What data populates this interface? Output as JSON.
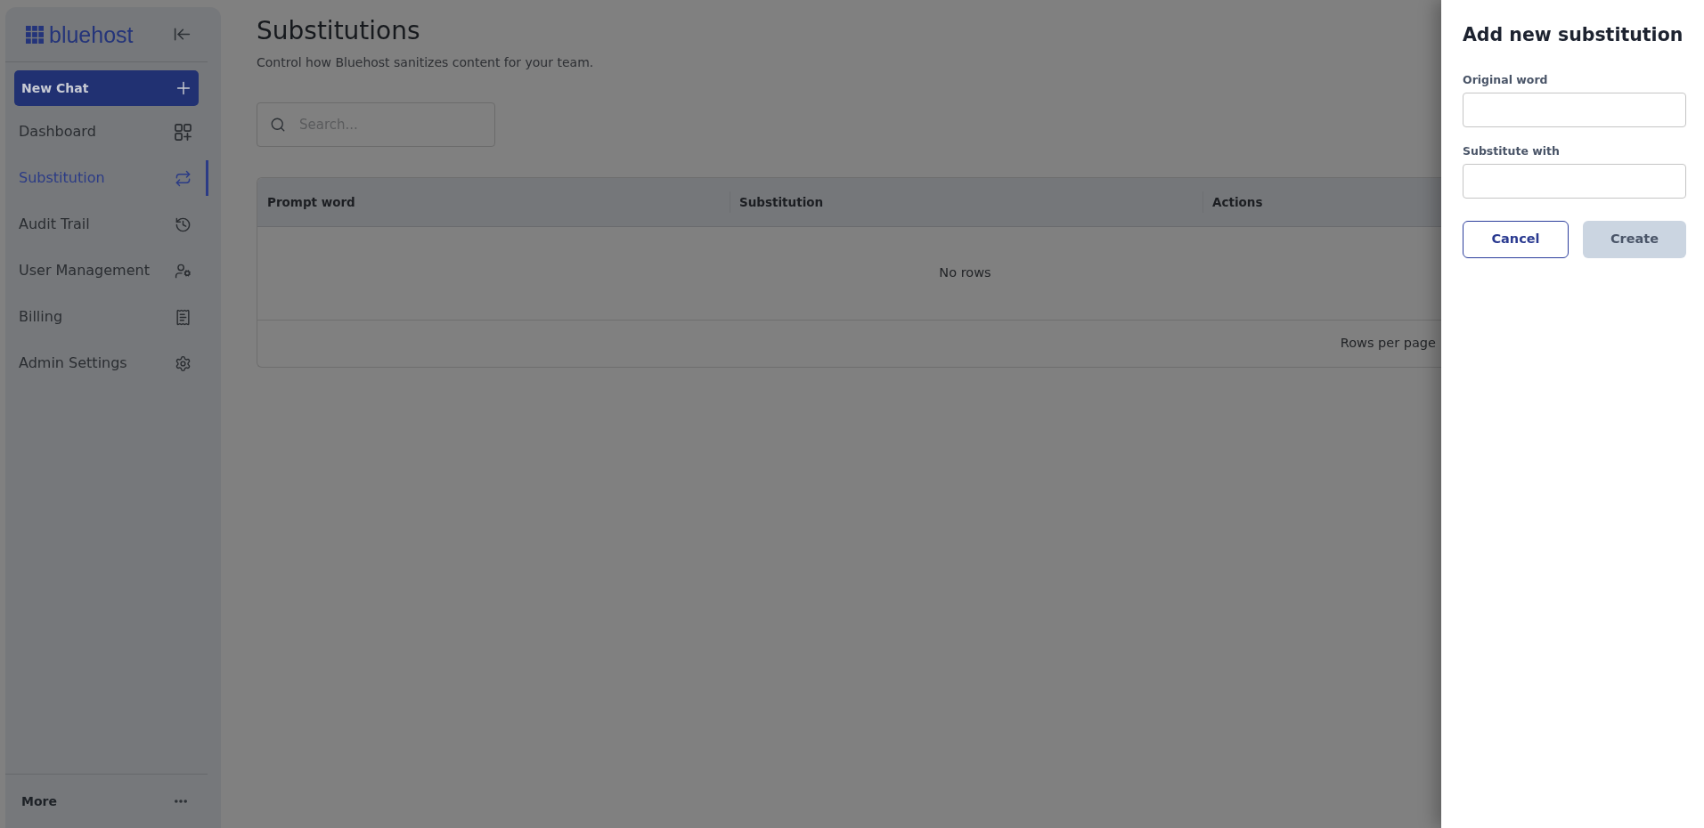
{
  "sidebar": {
    "logo": {
      "text": "bluehost"
    },
    "new_chat": {
      "label": "New Chat"
    },
    "items": [
      {
        "label": "Dashboard",
        "selected": false
      },
      {
        "label": "Substitution",
        "selected": true
      },
      {
        "label": "Audit Trail",
        "selected": false
      },
      {
        "label": "User Management",
        "selected": false
      },
      {
        "label": "Billing",
        "selected": false
      },
      {
        "label": "Admin Settings",
        "selected": false
      }
    ],
    "footer": {
      "label": "More"
    }
  },
  "page": {
    "title": "Substitutions",
    "subtitle": "Control how Bluehost sanitizes content for your team.",
    "search": {
      "placeholder": "Search..."
    }
  },
  "table": {
    "columns": [
      "Prompt word",
      "Substitution",
      "Actions"
    ],
    "empty_message": "No rows",
    "footer": {
      "label": "Rows per page"
    }
  },
  "panel": {
    "title": "Add new substitution",
    "fields": [
      {
        "label": "Original word"
      },
      {
        "label": "Substitute with"
      }
    ],
    "buttons": [
      {
        "label": "Cancel",
        "kind": "outline",
        "disabled": false
      },
      {
        "label": "Create",
        "kind": "primary",
        "disabled": true
      }
    ]
  }
}
